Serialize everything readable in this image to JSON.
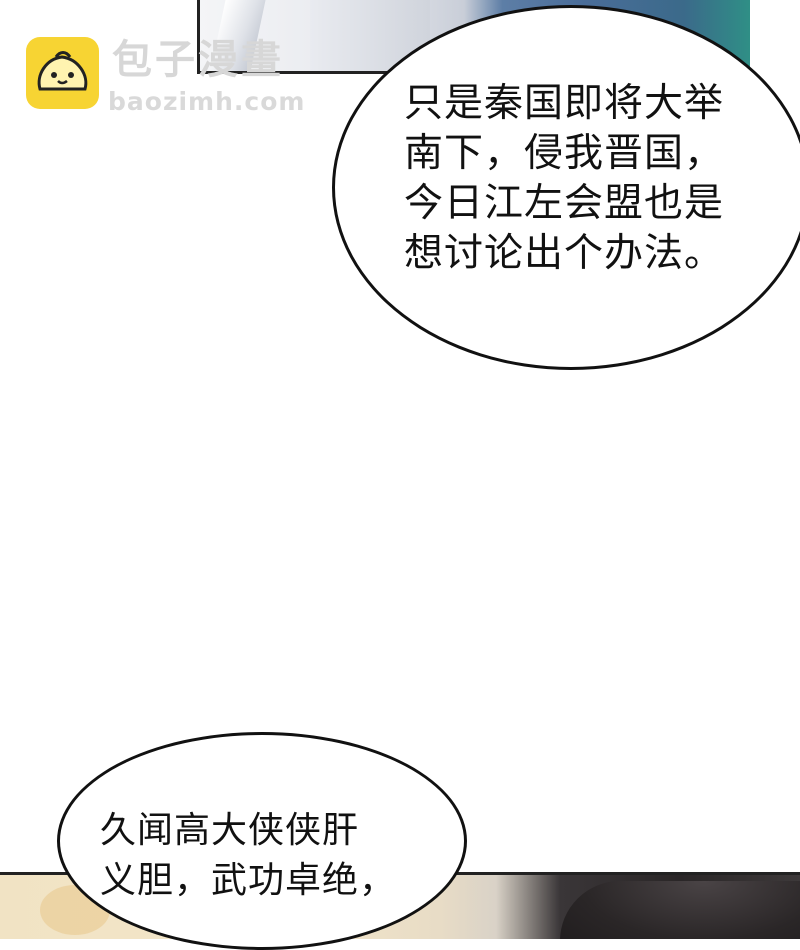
{
  "watermark": {
    "icon": "steamed-bun-mascot-icon",
    "name": "包子漫畫",
    "url": "baozimh.com",
    "colors": {
      "badge": "#f7d433",
      "text": "#d7d7d7"
    }
  },
  "speech_bubbles": [
    {
      "text": "只是秦国即将大举\n南下，侵我晋国，\n今日江左会盟也是\n想讨论出个办法。"
    },
    {
      "text": "久闻高大侠侠肝\n义胆，武功卓绝，"
    }
  ]
}
